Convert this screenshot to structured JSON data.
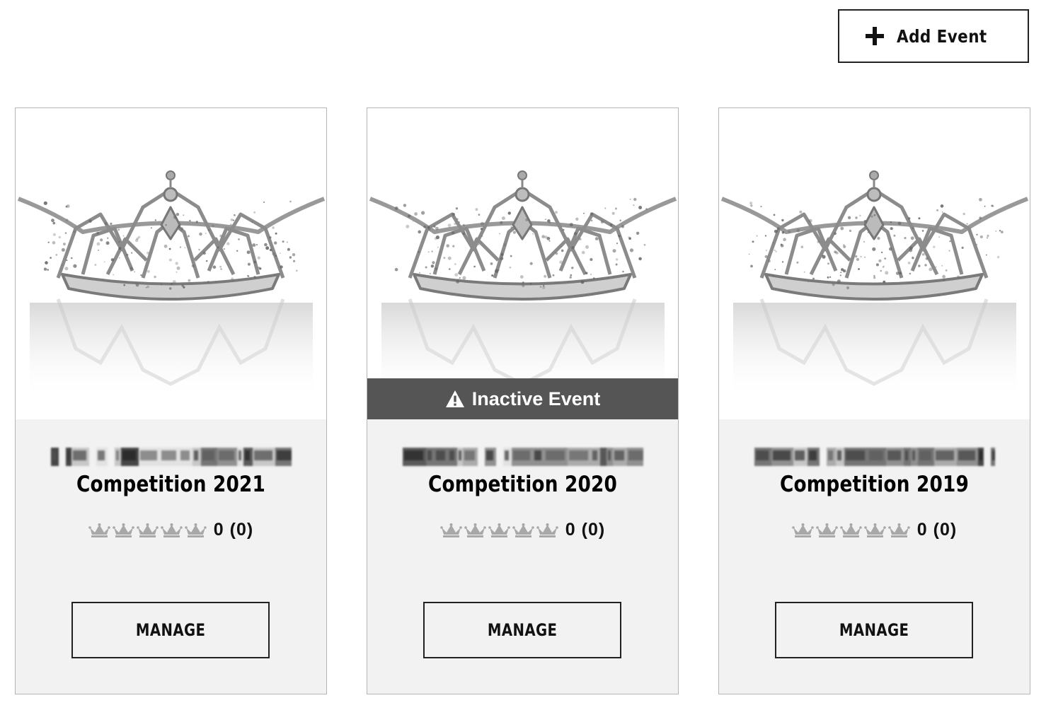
{
  "header": {
    "add_event_label": "Add Event"
  },
  "colors": {
    "banner": "#555555",
    "card_background": "#f2f2f2",
    "crown": "#a8a8a8"
  },
  "cards": [
    {
      "title": "Competition 2021",
      "rating_text": "0 (0)",
      "crowns_filled": 0,
      "crowns_total": 5,
      "inactive": false,
      "manage_label": "MANAGE"
    },
    {
      "title": "Competition 2020",
      "rating_text": "0 (0)",
      "crowns_filled": 0,
      "crowns_total": 5,
      "inactive": true,
      "banner_text": "Inactive Event",
      "manage_label": "MANAGE"
    },
    {
      "title": "Competition 2019",
      "rating_text": "0 (0)",
      "crowns_filled": 0,
      "crowns_total": 5,
      "inactive": false,
      "manage_label": "MANAGE"
    }
  ]
}
